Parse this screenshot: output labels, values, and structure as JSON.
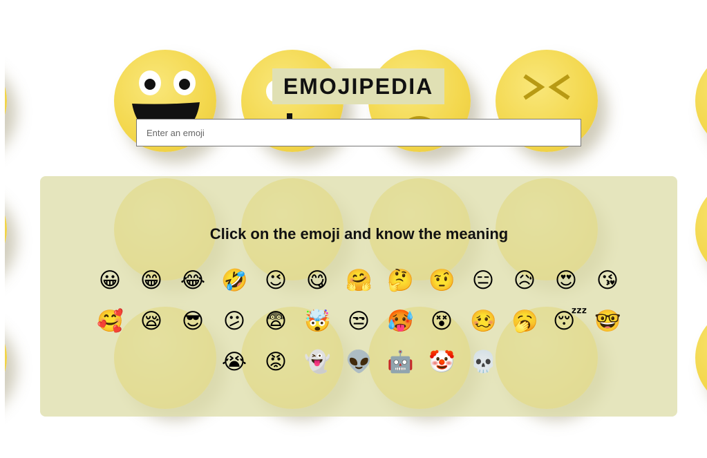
{
  "header": {
    "title": "EMOJIPEDIA"
  },
  "search": {
    "placeholder": "Enter an emoji",
    "value": ""
  },
  "panel": {
    "heading": "Click on the emoji and know the meaning",
    "emoji_rows": [
      [
        "😀",
        "😁",
        "😂",
        "🤣",
        "😉",
        "😋",
        "🤗",
        "🤔",
        "🤨",
        "😑",
        "😥",
        "😍",
        "😘"
      ],
      [
        "🥰",
        "😪",
        "😎",
        "😕",
        "😨",
        "🤯",
        "😒",
        "🥵",
        "😵",
        "🥴",
        "🥱",
        "😴",
        "🤓"
      ],
      [
        "😭",
        "😡",
        "👻",
        "👽",
        "🤖",
        "🤡",
        "💀"
      ]
    ]
  },
  "background": {
    "icon": "emoji-faces-wallpaper",
    "face_color": "#f3d74c",
    "panel_color": "#deDEAA"
  }
}
